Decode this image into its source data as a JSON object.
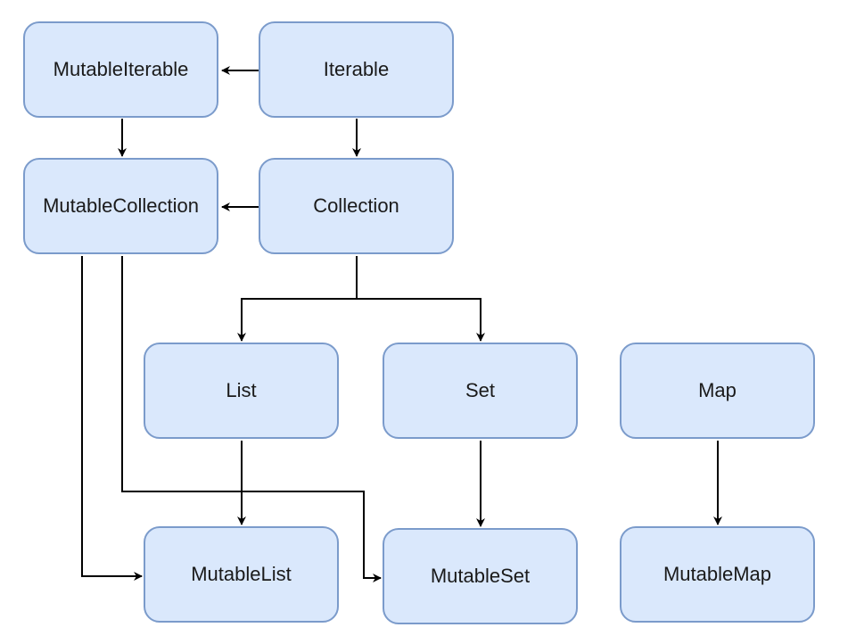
{
  "colors": {
    "fill": "#dae8fc",
    "stroke": "#7b9bcb",
    "edge": "#000000"
  },
  "nodes": {
    "mutable_iterable": "MutableIterable",
    "iterable": "Iterable",
    "mutable_collection": "MutableCollection",
    "collection": "Collection",
    "list": "List",
    "set": "Set",
    "map": "Map",
    "mutable_list": "MutableList",
    "mutable_set": "MutableSet",
    "mutable_map": "MutableMap"
  },
  "edges": [
    {
      "from": "Iterable",
      "to": "MutableIterable"
    },
    {
      "from": "MutableIterable",
      "to": "MutableCollection"
    },
    {
      "from": "Iterable",
      "to": "Collection"
    },
    {
      "from": "Collection",
      "to": "MutableCollection"
    },
    {
      "from": "Collection",
      "to": "List"
    },
    {
      "from": "Collection",
      "to": "Set"
    },
    {
      "from": "List",
      "to": "MutableList"
    },
    {
      "from": "Set",
      "to": "MutableSet"
    },
    {
      "from": "Map",
      "to": "MutableMap"
    },
    {
      "from": "MutableCollection",
      "to": "MutableList"
    },
    {
      "from": "MutableCollection",
      "to": "MutableSet"
    }
  ]
}
